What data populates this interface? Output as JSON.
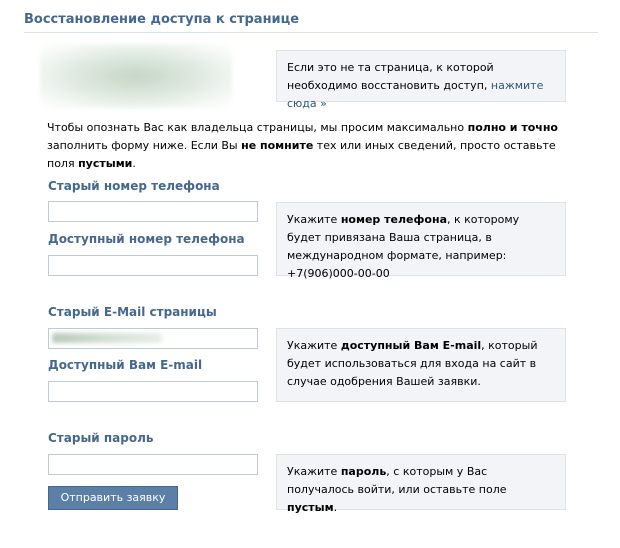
{
  "header": {
    "title": "Восстановление доступа к странице"
  },
  "wrong_page_box": {
    "text": "Если это не та страница, к которой необходимо восстановить доступ,",
    "link": "нажмите сюда »"
  },
  "intro": {
    "part1": "Чтобы опознать Вас как владельца страницы, мы просим максимально ",
    "bold1": "полно и точно",
    "part2": " заполнить форму ниже. Если Вы ",
    "bold2": "не помните",
    "part3": " тех или иных сведений, просто оставьте поля ",
    "bold3": "пустыми",
    "part4": "."
  },
  "phone_section": {
    "old_label": "Старый номер телефона",
    "old_value": "",
    "new_label": "Доступный номер телефона",
    "new_value": "",
    "hint": {
      "part1": "Укажите ",
      "bold": "номер телефона",
      "part2": ", к которому будет привязана Ваша страница, в международном формате, например: +7(906)000-00-00"
    }
  },
  "email_section": {
    "old_label": "Старый E-Mail страницы",
    "new_label": "Доступный Вам E-mail",
    "new_value": "",
    "hint": {
      "part1": "Укажите ",
      "bold": "доступный Вам E-mail",
      "part2": ", который будет использоваться для входа на сайт в случае одобрения Вашей заявки."
    }
  },
  "password_section": {
    "label": "Старый пароль",
    "value": "",
    "hint": {
      "part1": "Укажите ",
      "bold1": "пароль",
      "part2": ", с которым у Вас получалось войти, или оставьте поле ",
      "bold2": "пустым",
      "part3": "."
    }
  },
  "submit_button": {
    "label": "Отправить заявку"
  }
}
